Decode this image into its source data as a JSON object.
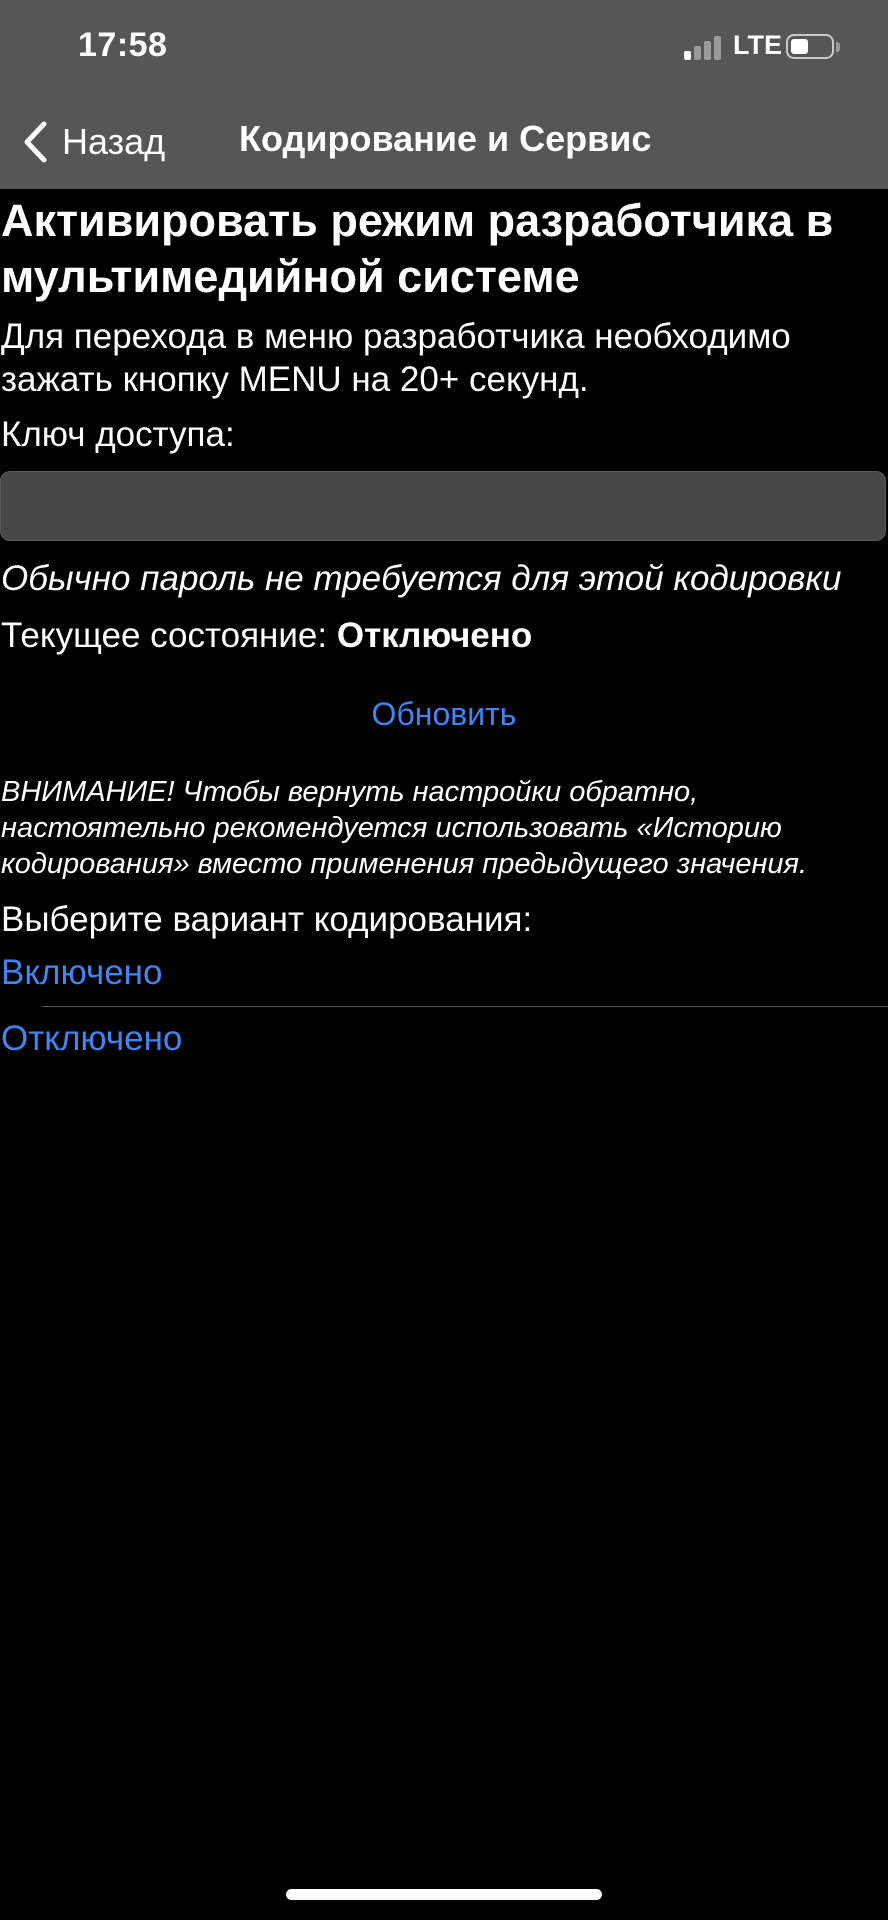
{
  "status_bar": {
    "time": "17:58",
    "network": "LTE",
    "signal_bars_active": 1,
    "signal_bars_total": 4,
    "battery_level": 0.45
  },
  "nav": {
    "back_label": "Назад",
    "title": "Кодирование и Сервис"
  },
  "content": {
    "heading": "Активировать режим разработчика в мультимедийной системе",
    "description": "Для перехода в меню разработчика необходимо зажать кнопку MENU на 20+ секунд.",
    "key_label": "Ключ доступа:",
    "key_value": "",
    "hint": "Обычно пароль не требуется для этой кодировки",
    "state_label": "Текущее состояние: ",
    "state_value": "Отключено",
    "refresh_label": "Обновить",
    "warning": "ВНИМАНИЕ! Чтобы вернуть настройки обратно, настоятельно рекомендуется использовать «Историю кодирования» вместо применения предыдущего значения.",
    "choose_label": "Выберите вариант кодирования:",
    "options": [
      {
        "label": "Включено"
      },
      {
        "label": "Отключено"
      }
    ]
  },
  "colors": {
    "accent": "#3f85f4",
    "bar_background": "#565656",
    "page_background": "#000000",
    "input_background": "#474747"
  }
}
